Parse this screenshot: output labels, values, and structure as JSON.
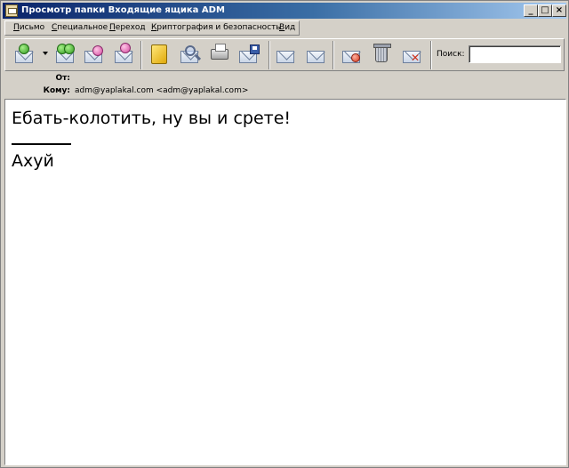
{
  "window": {
    "title": "Просмотр папки Входящие ящика ADM"
  },
  "titlebar_buttons": {
    "minimize": "_",
    "maximize": "□",
    "close": "×"
  },
  "menu": {
    "items": [
      {
        "label": "Письмо"
      },
      {
        "label": "Специальное"
      },
      {
        "label": "Переход"
      },
      {
        "label": "Криптография и безопасность"
      },
      {
        "label": "Вид"
      }
    ]
  },
  "toolbar": {
    "buttons": [
      {
        "icon": "new-message-icon"
      },
      {
        "icon": "reply-all-icon"
      },
      {
        "icon": "forward-icon"
      },
      {
        "icon": "redirect-icon"
      },
      {
        "icon": "address-book-icon"
      },
      {
        "icon": "find-icon"
      },
      {
        "icon": "print-icon"
      },
      {
        "icon": "save-icon"
      },
      {
        "icon": "previous-message-icon"
      },
      {
        "icon": "next-message-icon"
      },
      {
        "icon": "mark-icon"
      },
      {
        "icon": "trash-icon"
      },
      {
        "icon": "delete-message-icon"
      }
    ],
    "search_label": "Поиск:",
    "search_value": ""
  },
  "headers": {
    "from_label": "От:",
    "from_value": "",
    "to_label": "Кому:",
    "to_value": "adm@yaplakal.com <adm@yaplakal.com>"
  },
  "message": {
    "line1": "Ебать-колотить, ну вы и срете!",
    "signature": "Ахуй"
  }
}
